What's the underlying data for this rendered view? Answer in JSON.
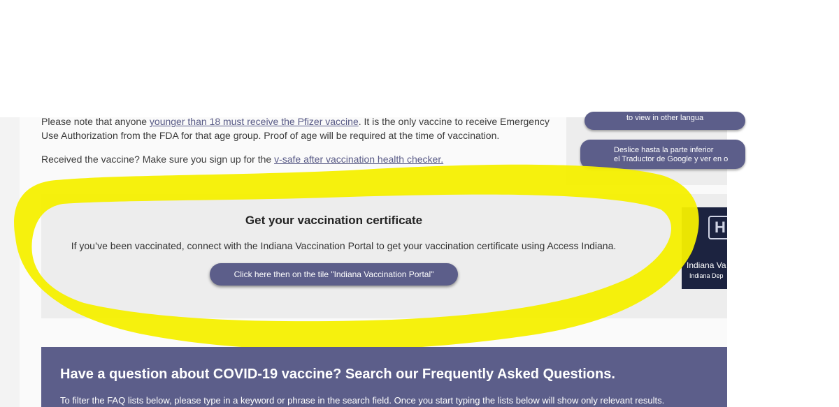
{
  "intro": {
    "age_note_prefix": "Please note that anyone ",
    "age_note_link": "younger than 18 must receive the Pfizer vaccine",
    "age_note_suffix": ". It is the only vaccine to receive Emergency Use Authorization from the FDA for that age group. Proof of age will be required at the time of vaccination.",
    "vsafe_prefix": "Received the vaccine? Make sure you sign up for the ",
    "vsafe_link": "v-safe after vaccination health checker."
  },
  "side_panel": {
    "button1_label": "to view in other langua",
    "button2_line1": "Deslice hasta la parte inferior",
    "button2_line2": "el Traductor de Google y ver en o"
  },
  "certificate": {
    "title": "Get your vaccination certificate",
    "description": "If you’ve been vaccinated, connect with the Indiana Vaccination Portal to get your vaccination certificate using Access Indiana.",
    "button_label": "Click here then on the tile \"Indiana Vaccination Portal\""
  },
  "portal_tile": {
    "name": "Indiana Va",
    "subtitle": "Indiana Dep",
    "logo_icon": "hh-logo-icon"
  },
  "faq": {
    "title": "Have a question about COVID-19 vaccine? Search our Frequently Asked Questions.",
    "description": "To filter the FAQ lists below, please type in a keyword or phrase in the search field. Once you start typing the lists below will show only relevant results."
  },
  "colors": {
    "highlight": "#f5f000",
    "button": "#5c5e8a",
    "faq_banner": "#5c5e8a",
    "tile": "#1c2340"
  }
}
